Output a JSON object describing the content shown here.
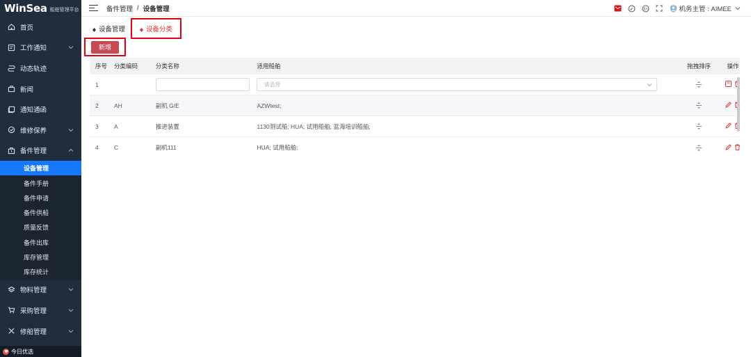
{
  "app": {
    "brand": "WinSea",
    "subtitle": "船舶管理平台"
  },
  "sidebar": {
    "items": [
      {
        "label": "首页",
        "icon": "home-icon",
        "expandable": false
      },
      {
        "label": "工作通知",
        "icon": "notice-icon",
        "expandable": true
      },
      {
        "label": "动态轨迹",
        "icon": "track-icon",
        "expandable": false
      },
      {
        "label": "新闻",
        "icon": "news-icon",
        "expandable": false
      },
      {
        "label": "通知通函",
        "icon": "bulletin-icon",
        "expandable": false
      },
      {
        "label": "维修保养",
        "icon": "maintenance-icon",
        "expandable": true
      },
      {
        "label": "备件管理",
        "icon": "parts-icon",
        "expandable": true,
        "expanded": true
      }
    ],
    "submenu": [
      {
        "label": "设备管理",
        "active": true
      },
      {
        "label": "备件手册"
      },
      {
        "label": "备件申请"
      },
      {
        "label": "备件供船"
      },
      {
        "label": "质量反馈"
      },
      {
        "label": "备件出库"
      },
      {
        "label": "库存管理"
      },
      {
        "label": "库存统计"
      }
    ],
    "items_after": [
      {
        "label": "物料管理",
        "icon": "material-icon",
        "expandable": true
      },
      {
        "label": "采购管理",
        "icon": "cart-icon",
        "expandable": true
      },
      {
        "label": "修船管理",
        "icon": "repair-icon",
        "expandable": true
      }
    ],
    "bottom_label": "今日优选"
  },
  "header": {
    "breadcrumb": [
      "备件管理",
      "设备管理"
    ],
    "separator": "/",
    "user": "机务主管 : AIMEE"
  },
  "tabs": [
    {
      "label": "设备管理",
      "active": false
    },
    {
      "label": "设备分类",
      "active": true
    }
  ],
  "toolbar": {
    "add_label": "新增"
  },
  "table": {
    "columns": {
      "idx": "序号",
      "code": "分类编码",
      "name": "分类名称",
      "ships": "适用船舶",
      "drag": "拖拽排序",
      "ops": "操作"
    },
    "new_row": {
      "idx": "1",
      "select_placeholder": "请选择"
    },
    "rows": [
      {
        "idx": "2",
        "code": "AH",
        "name": "副机 G/E",
        "ships": "AZWtest;"
      },
      {
        "idx": "3",
        "code": "A",
        "name": "推进装置",
        "ships": "1130测试船; HUA; 试用船舶; 蓝海培训船舶;"
      },
      {
        "idx": "4",
        "code": "C",
        "name": "副机111",
        "ships": "HUA; 试用船舶;"
      }
    ]
  },
  "colors": {
    "sidebar_bg": "#1f2d3d",
    "active_blue": "#1677ff",
    "accent_red": "#c74a52",
    "highlight_border": "#e60012"
  }
}
